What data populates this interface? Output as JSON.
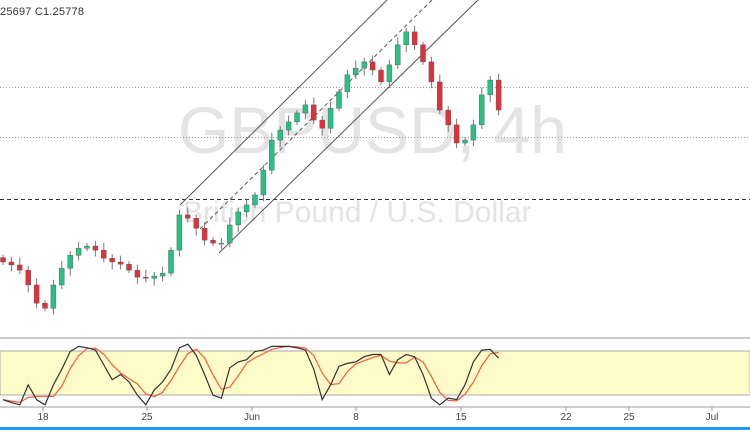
{
  "header": {
    "ohlc_text": "25697  C1.25778"
  },
  "watermark": {
    "symbol": "GBPUSD, 4h",
    "description": "British Pound / U.S. Dollar"
  },
  "colors": {
    "up": "#26c281",
    "down": "#e0303a",
    "k_line": "#333333",
    "d_line": "#ff5a36",
    "band": "#fffbc8",
    "accent": "#2196f3"
  },
  "chart_data": {
    "type": "candlestick",
    "title": "GBPUSD, 4h",
    "price_range": [
      1.1966,
      1.287
    ],
    "first_open": 1.2175,
    "closes": [
      1.2163,
      1.2155,
      1.2141,
      1.2101,
      1.2052,
      1.2038,
      1.2101,
      1.2146,
      1.2181,
      1.22,
      1.2206,
      1.2195,
      1.2173,
      1.2163,
      1.2157,
      1.2141,
      1.2122,
      1.2119,
      1.2125,
      1.2133,
      1.2195,
      1.229,
      1.2281,
      1.2254,
      1.2222,
      1.2214,
      1.2214,
      1.2263,
      1.2298,
      1.2317,
      1.2344,
      1.2411,
      1.2492,
      1.2519,
      1.2541,
      1.2565,
      1.2587,
      1.2546,
      1.2524,
      1.2578,
      1.2622,
      1.2668,
      1.2686,
      1.2703,
      1.2681,
      1.2649,
      1.2695,
      1.2749,
      1.2784,
      1.2749,
      1.2703,
      1.2649,
      1.2573,
      1.2533,
      1.2484,
      1.2492,
      1.2533,
      1.2614,
      1.2654,
      1.2573
    ],
    "horizontal_levels": [
      {
        "price": 1.2635,
        "style": "dotted"
      },
      {
        "price": 1.25,
        "style": "dotted"
      },
      {
        "price": 1.2333,
        "style": "dashed"
      }
    ],
    "x_tick_labels": [
      "18",
      "25",
      "Jun",
      "8",
      "15",
      "22",
      "25",
      "Jul"
    ],
    "stochastic": {
      "range": [
        0,
        100
      ],
      "bands": [
        20,
        80
      ],
      "k": [
        14,
        10,
        7,
        34,
        14,
        7,
        34,
        55,
        79,
        86,
        84,
        81,
        61,
        41,
        48,
        38,
        20,
        7,
        27,
        38,
        55,
        84,
        89,
        74,
        48,
        20,
        16,
        57,
        65,
        68,
        79,
        81,
        86,
        86,
        86,
        84,
        81,
        55,
        14,
        34,
        59,
        63,
        65,
        72,
        75,
        75,
        48,
        68,
        75,
        72,
        48,
        16,
        7,
        16,
        14,
        34,
        65,
        81,
        82,
        70
      ]
    }
  }
}
